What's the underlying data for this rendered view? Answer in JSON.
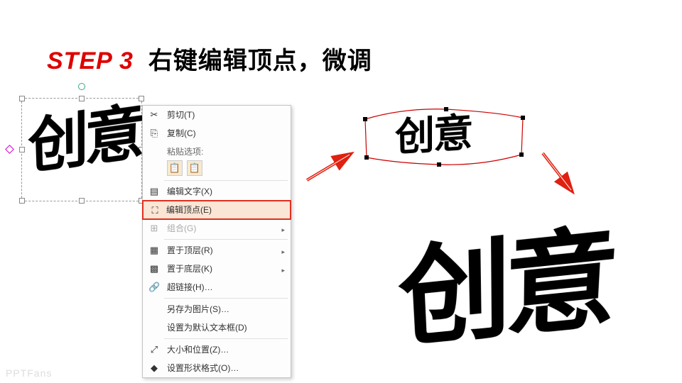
{
  "title": {
    "step": "STEP 3",
    "rest": "右键编辑顶点，微调"
  },
  "wordart_sample": "创意",
  "edit_points_sample": "创意",
  "final_sample": "创意",
  "menu": {
    "cut": "剪切(T)",
    "copy": "复制(C)",
    "paste_label": "粘贴选项:",
    "edit_text": "编辑文字(X)",
    "edit_points": "编辑顶点(E)",
    "group": "组合(G)",
    "bring_front": "置于顶层(R)",
    "send_back": "置于底层(K)",
    "hyperlink": "超链接(H)…",
    "save_as_pic": "另存为图片(S)…",
    "set_default": "设置为默认文本框(D)",
    "size_pos": "大小和位置(Z)…",
    "format_shape": "设置形状格式(O)…"
  },
  "icons": {
    "cut": "✂",
    "copy": "⎘",
    "paste1": "📋",
    "paste2": "📋",
    "edit_text": "▤",
    "edit_points": "⛶",
    "group": "⊞",
    "front": "▦",
    "back": "▩",
    "link": "🔗",
    "size": "⤢",
    "format": "◆"
  },
  "watermark": "PPTFans"
}
